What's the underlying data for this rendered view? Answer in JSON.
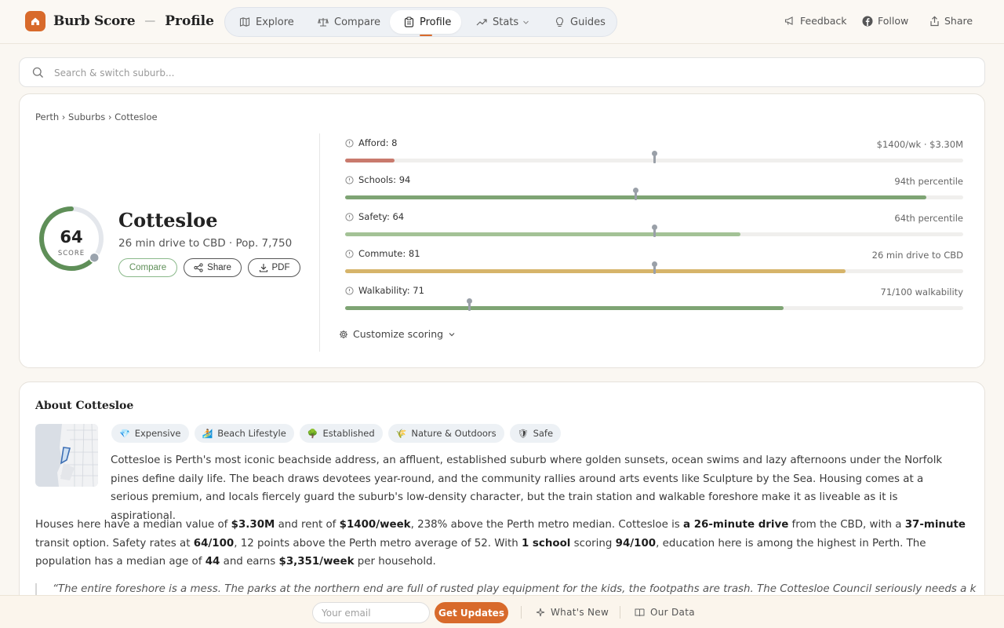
{
  "header": {
    "brand": "Burb Score",
    "separator": "—",
    "page": "Profile",
    "nav": [
      {
        "label": "Explore",
        "icon": "map-icon"
      },
      {
        "label": "Compare",
        "icon": "scale-icon"
      },
      {
        "label": "Profile",
        "icon": "clipboard-icon",
        "active": true
      },
      {
        "label": "Stats",
        "icon": "trending-up-icon"
      },
      {
        "label": "Guides",
        "icon": "lightbulb-icon"
      }
    ],
    "links": [
      {
        "label": "Feedback",
        "icon": "megaphone-icon"
      },
      {
        "label": "Follow",
        "icon": "facebook-icon"
      },
      {
        "label": "Share",
        "icon": "share-icon"
      }
    ]
  },
  "search": {
    "placeholder": "Search & switch suburb..."
  },
  "profile": {
    "breadcrumb": "Perth › Suburbs › Cottesloe",
    "score": "64",
    "score_label": "SCORE",
    "score_fraction": 0.64,
    "name": "Cottesloe",
    "meta": "26 min drive to CBD · Pop. 7,750",
    "buttons": {
      "compare": "Compare",
      "share": "Share",
      "pdf": "PDF"
    },
    "metrics": [
      {
        "label": "Afford: 8",
        "value": "$1400/wk · $3.30M",
        "fill": 0.08,
        "marker": 0.5,
        "color": "#c97a6d"
      },
      {
        "label": "Schools: 94",
        "value": "94th percentile",
        "fill": 0.94,
        "marker": 0.47,
        "color": "#7ea474"
      },
      {
        "label": "Safety: 64",
        "value": "64th percentile",
        "fill": 0.64,
        "marker": 0.5,
        "color": "#a3c296"
      },
      {
        "label": "Commute: 81",
        "value": "26 min drive to CBD",
        "fill": 0.81,
        "marker": 0.5,
        "color": "#d6b46a"
      },
      {
        "label": "Walkability: 71",
        "value": "71/100 walkability",
        "fill": 0.71,
        "marker": 0.2,
        "color": "#7ea474"
      }
    ],
    "customize": "Customize scoring"
  },
  "about": {
    "title": "About Cottesloe",
    "tags": [
      {
        "label": "Expensive",
        "icon": "💎"
      },
      {
        "label": "Beach Lifestyle",
        "icon": "🏄"
      },
      {
        "label": "Established",
        "icon": "🌳"
      },
      {
        "label": "Nature & Outdoors",
        "icon": "🌾"
      },
      {
        "label": "Safe",
        "icon": "🛡"
      }
    ],
    "intro": "Cottesloe is Perth's most iconic beachside address, an affluent, established suburb where golden sunsets, ocean swims and lazy afternoons under the Norfolk pines define daily life. The beach draws devotees year-round, and the community rallies around arts events like Sculpture by the Sea. Housing comes at a serious premium, and locals fiercely guard the suburb's low-density character, but the train station and walkable foreshore make it as liveable as it is aspirational.",
    "stats": {
      "t1": "Houses here have a median value of ",
      "median_value": "$3.30M",
      "t2": " and rent of ",
      "rent": "$1400/week",
      "t3": ", 238% above the Perth metro median. Cottesloe is ",
      "drive": "a 26-minute drive",
      "t4": " from the CBD, with a ",
      "transit": "37-minute",
      "t5": " transit option. Safety rates at ",
      "safety": "64/100",
      "t6": ", 12 points above the Perth metro average of 52. With ",
      "schools": "1 school",
      "t7": " scoring ",
      "school_score": "94/100",
      "t8": ", education here is among the highest in Perth. The population has a median age of ",
      "age": "44",
      "t9": " and earns ",
      "income": "$3,351/week",
      "t10": " per household."
    },
    "quote": "“The entire foreshore is a mess. The parks at the northern end are full of rusted play equipment for the kids, the footpaths are trash. The Cottesloe Council seriously needs a kick up the"
  },
  "footer": {
    "email_placeholder": "Your email",
    "cta": "Get Updates",
    "whats_new": "What's New",
    "our_data": "Our Data"
  },
  "colors": {
    "accent": "#d86a2b",
    "score_arc": "#5f8f58",
    "compare_border": "#8ab98a"
  }
}
